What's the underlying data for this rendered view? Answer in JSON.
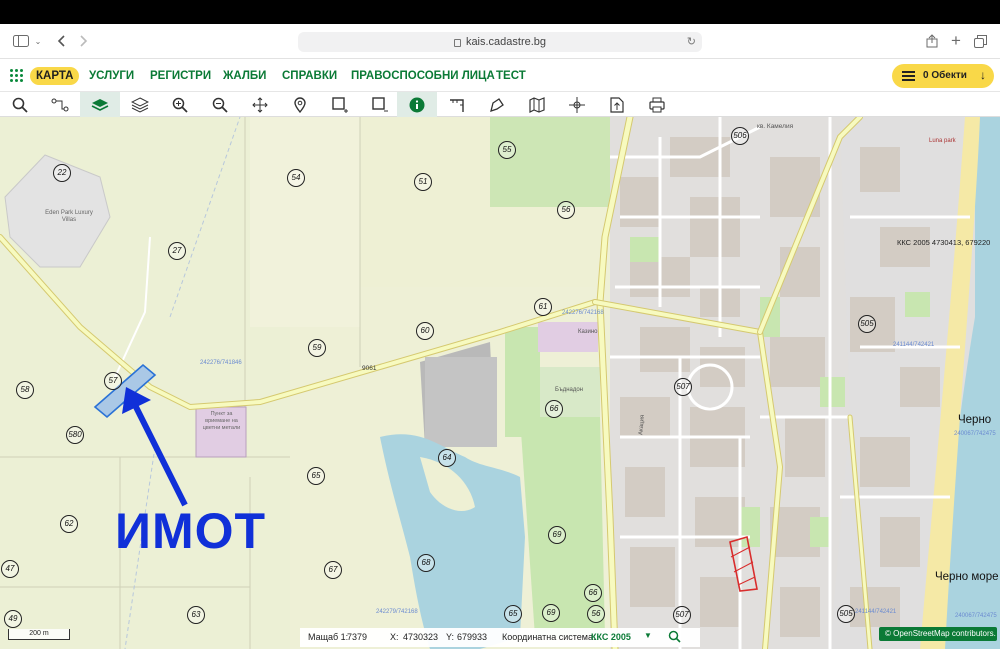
{
  "browser": {
    "url": "kais.cadastre.bg"
  },
  "nav": {
    "items": [
      "КАРТА",
      "УСЛУГИ",
      "РЕГИСТРИ",
      "ЖАЛБИ",
      "СПРАВКИ",
      "ПРАВОСПОСОБНИ ЛИЦА",
      "ТЕСТ"
    ],
    "objects_label": "0 Обекти"
  },
  "toolbar": {
    "tools": [
      "search-icon",
      "route-icon",
      "layers-active-icon",
      "layers-icon",
      "zoom-in-icon",
      "zoom-out-icon",
      "pan-icon",
      "pin-icon",
      "select-add-icon",
      "select-remove-icon",
      "info-icon",
      "measure-icon",
      "draw-icon",
      "map-icon",
      "coordinate-icon",
      "export-icon",
      "print-icon"
    ]
  },
  "map": {
    "top_coord": "ККС 2005 4730413, 679220",
    "parcels": [
      "22",
      "54",
      "51",
      "55",
      "56",
      "506",
      "27",
      "61",
      "60",
      "59",
      "57",
      "58",
      "580",
      "66",
      "65",
      "64",
      "62",
      "69",
      "68",
      "67",
      "47",
      "49",
      "63",
      "66",
      "507",
      "505",
      "505",
      "507",
      "56",
      "65",
      "69"
    ],
    "small_labels": [
      "242279/742168",
      "242276/741846",
      "242276/742168",
      "Eden Park Luxury Villas",
      "Пункт за вриемане на цветни метали",
      "9061",
      "Luna park",
      "кв. Камелия",
      "241144/742421",
      "240067/742475",
      "241144/742421",
      "240067/742475",
      "Акация",
      "Казино",
      "Бъднадон"
    ],
    "sea_labels": [
      "Черно",
      "Черно море"
    ],
    "annotation": "ИМОТ",
    "colors": {
      "water": "#aad3df",
      "green": "#c8e6b0",
      "urban": "#e0dfdf",
      "road": "#f7fabf",
      "road_edge": "#d5c970",
      "annotation": "#1030d8"
    }
  },
  "status": {
    "scale_label": "Мащаб 1:",
    "scale_value": "7379",
    "x_label": "X:",
    "x_value": "4730323",
    "y_label": "Y:",
    "y_value": "679933",
    "system_label": "Координатна система:",
    "system_value": "ККС 2005",
    "scalebar": "200 m",
    "attribution": "© OpenStreetMap contributors."
  }
}
